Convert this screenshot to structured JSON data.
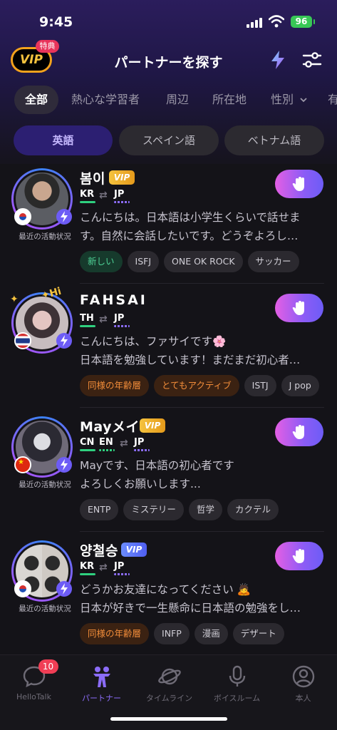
{
  "status": {
    "time": "9:45",
    "battery": "96"
  },
  "header": {
    "title": "パートナーを探す",
    "vip_label": "VIP",
    "vip_badge": "特典"
  },
  "categories": [
    "全部",
    "熱心な学習者",
    "周辺",
    "所在地",
    "性別",
    "有"
  ],
  "languages": [
    "英語",
    "スペイン語",
    "ベトナム語"
  ],
  "activity_label": "最近の活動状況",
  "partners": [
    {
      "name": "봄이",
      "vip": "VIP",
      "vip_style": "gold",
      "native": [
        "KR"
      ],
      "learning": "JP",
      "bio": [
        "こんにちは。日本語は小学生くらいで話せま",
        "す。自然に会話したいです。どうぞよろし…"
      ],
      "tags": [
        "新しい",
        "ISFJ",
        "ONE OK ROCK",
        "サッカー"
      ],
      "show_activity": true
    },
    {
      "name": "FAHSAI",
      "vip": "",
      "vip_style": "",
      "native": [
        "TH"
      ],
      "learning": "JP",
      "bio": [
        "こんにちは、ファサイです🌸",
        "日本語を勉強しています！まだまだ初心者…"
      ],
      "tags": [
        "同様の年齢層",
        "とてもアクティブ",
        "ISTJ",
        "J pop"
      ],
      "show_activity": false
    },
    {
      "name": "Mayメイ",
      "vip": "VIP",
      "vip_style": "gold",
      "native": [
        "CN",
        "EN"
      ],
      "learning": "JP",
      "bio": [
        "Mayです、日本語の初心者です",
        "よろしくお願いします..."
      ],
      "tags": [
        "ENTP",
        "ミステリー",
        "哲学",
        "カクテル"
      ],
      "show_activity": true
    },
    {
      "name": "양철승",
      "vip": "VIP",
      "vip_style": "blue",
      "native": [
        "KR"
      ],
      "learning": "JP",
      "bio": [
        "どうかお友達になってください 🙇",
        "日本が好きで一生懸命に日本語の勉強をし…"
      ],
      "tags": [
        "同様の年齢層",
        "INFP",
        "漫画",
        "デザート"
      ],
      "show_activity": true
    }
  ],
  "nav": {
    "items": [
      "HelloTalk",
      "パートナー",
      "タイムライン",
      "ボイスルーム",
      "本人"
    ],
    "badge": "10"
  },
  "colors": {
    "accent": "#8b6cf8",
    "vip_gold": "#f5c33e",
    "new_green": "#4ed196",
    "orange_tag": "#f48e3a"
  }
}
